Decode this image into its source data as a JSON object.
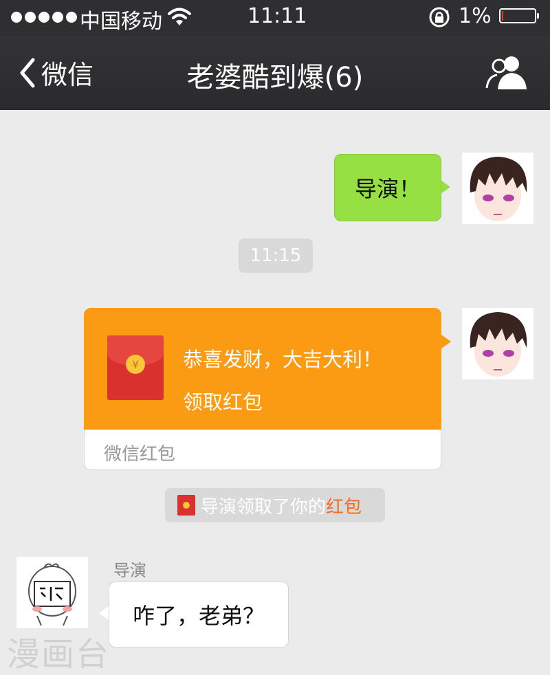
{
  "status_bar": {
    "carrier": "中国移动",
    "time": "11:11",
    "battery_percent": "1%",
    "signal_dots": 5,
    "battery_level": 0.01,
    "icons": [
      "signal-dots-icon",
      "wifi-icon",
      "orientation-lock-icon",
      "battery-icon"
    ]
  },
  "nav": {
    "back_label": "微信",
    "title": "老婆酷到爆(6)",
    "back_icon": "chevron-left-icon",
    "members_icon": "group-members-icon"
  },
  "messages": {
    "msg1": {
      "text": "导演！",
      "side": "right",
      "bubble_color": "#96e043"
    },
    "timestamp": "11:15",
    "red_packet": {
      "title": "恭喜发财，大吉大利！",
      "action": "领取红包",
      "footer": "微信红包",
      "color": "#fb9b13",
      "icon": "red-envelope-icon"
    },
    "notice": {
      "prefix": "导演领取了你的",
      "highlight": "红包",
      "highlight_color": "#f36c21"
    },
    "msg2": {
      "sender": "导演",
      "text": "咋了，老弟？",
      "side": "left"
    }
  },
  "watermark": "漫画台"
}
